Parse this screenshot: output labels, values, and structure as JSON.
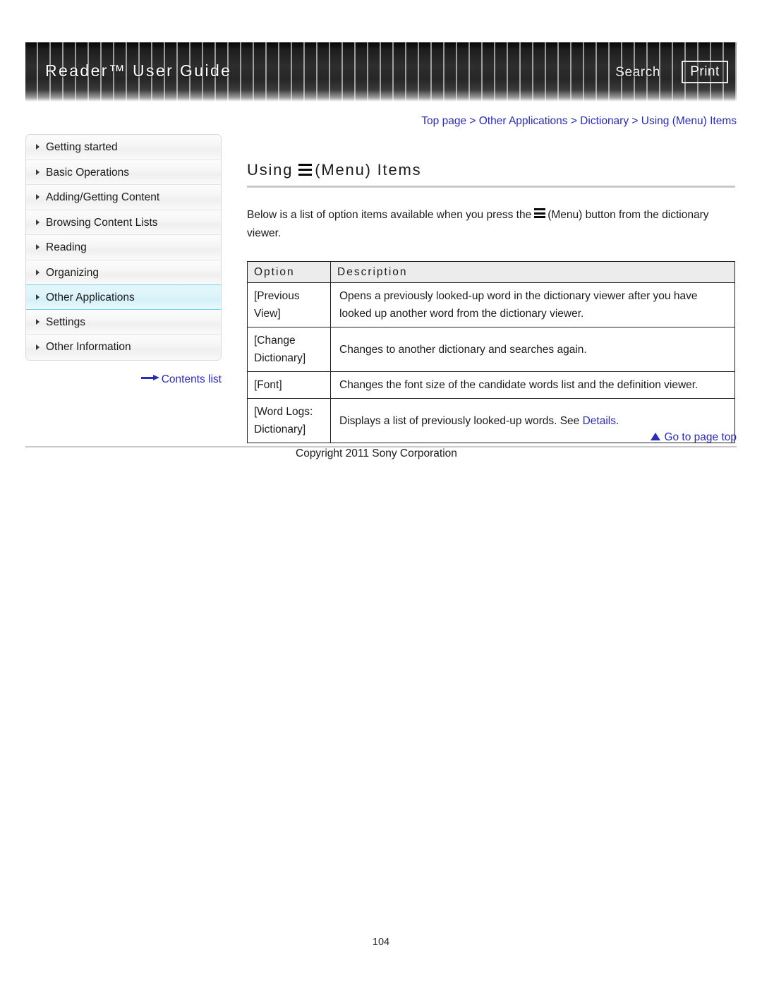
{
  "header": {
    "title": "Reader™ User Guide",
    "search_label": "Search",
    "print_label": "Print"
  },
  "breadcrumb": {
    "text": "Top page > Other Applications > Dictionary > Using (Menu) Items"
  },
  "sidebar": {
    "items": [
      {
        "label": "Getting started",
        "active": false
      },
      {
        "label": "Basic Operations",
        "active": false
      },
      {
        "label": "Adding/Getting Content",
        "active": false
      },
      {
        "label": "Browsing Content Lists",
        "active": false
      },
      {
        "label": "Reading",
        "active": false
      },
      {
        "label": "Organizing",
        "active": false
      },
      {
        "label": "Other Applications",
        "active": true
      },
      {
        "label": "Settings",
        "active": false
      },
      {
        "label": "Other Information",
        "active": false
      }
    ],
    "contents_link": "Contents list"
  },
  "main": {
    "title_prefix": "Using",
    "title_suffix": "(Menu) Items",
    "intro_before": "Below is a list of option items available when you press the",
    "intro_after": "(Menu) button from the dictionary viewer.",
    "table": {
      "columns": [
        "Option",
        "Description"
      ],
      "rows": [
        {
          "option": "[Previous View]",
          "description": "Opens a previously looked-up word in the dictionary viewer after you have looked up another word from the dictionary viewer.",
          "link": null
        },
        {
          "option": "[Change Dictionary]",
          "description": "Changes to another dictionary and searches again.",
          "link": null
        },
        {
          "option": "[Font]",
          "description": "Changes the font size of the candidate words list and the definition viewer.",
          "link": null
        },
        {
          "option": "[Word Logs: Dictionary]",
          "description_before": "Displays a list of previously looked-up words. See ",
          "link": "Details",
          "description_after": "."
        }
      ]
    }
  },
  "footer": {
    "go_to_top": "Go to page top",
    "copyright": "Copyright 2011 Sony Corporation",
    "page_number": "104"
  },
  "colors": {
    "link": "#2b2bbb",
    "active_nav_bg": "#ddf4fa",
    "active_nav_border": "#77d3e8",
    "table_header_bg": "#ececec"
  }
}
